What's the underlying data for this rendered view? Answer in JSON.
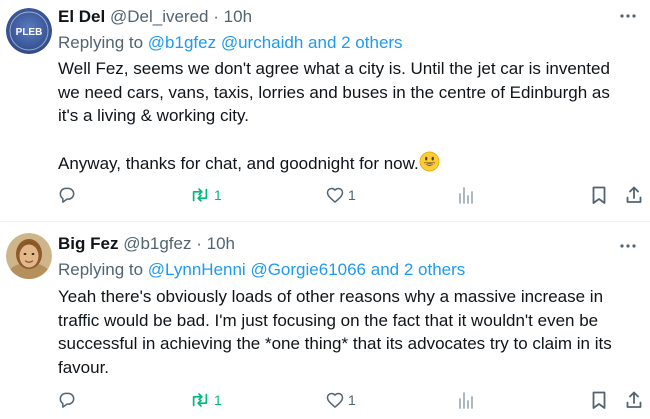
{
  "tweets": [
    {
      "avatar_text": "PLEB",
      "display_name": "El Del",
      "handle": "@Del_ivered",
      "separator": "·",
      "time": "10h",
      "replying_prefix": "Replying to",
      "replying_mentions": [
        "@b1gfez",
        "@urchaidh"
      ],
      "replying_suffix": "and 2 others",
      "body_lines": [
        "Well Fez, seems we don't agree what a city is. Until the jet car is invented",
        "we need cars, vans, taxis, lorries and buses in the centre of Edinburgh as",
        "it's a living & working city.",
        "",
        "Anyway, thanks for chat, and goodnight for now."
      ],
      "retweet_count": "1",
      "like_count": "1"
    },
    {
      "display_name": "Big Fez",
      "handle": "@b1gfez",
      "separator": "·",
      "time": "10h",
      "replying_prefix": "Replying to",
      "replying_mentions": [
        "@LynnHenni",
        "@Gorgie61066"
      ],
      "replying_suffix": "and 2 others",
      "body_lines": [
        "Yeah there's obviously loads of other reasons why a massive increase in",
        "traffic would be bad. I'm just focusing on the fact that it wouldn't even be",
        "successful in achieving the *one thing* that its advocates try to claim in its",
        "favour."
      ],
      "retweet_count": "1",
      "like_count": "1"
    }
  ],
  "colors": {
    "text": "#0f1419",
    "secondary": "#536471",
    "link": "#1d9bf0",
    "retweet": "#00ba7c",
    "divider": "#eff3f4",
    "pleb_avatar": "#3d5a9e"
  },
  "icons": [
    "more-icon",
    "reply-icon",
    "retweet-icon",
    "like-icon",
    "views-icon",
    "bookmark-icon",
    "share-icon",
    "grinning-emoji"
  ]
}
